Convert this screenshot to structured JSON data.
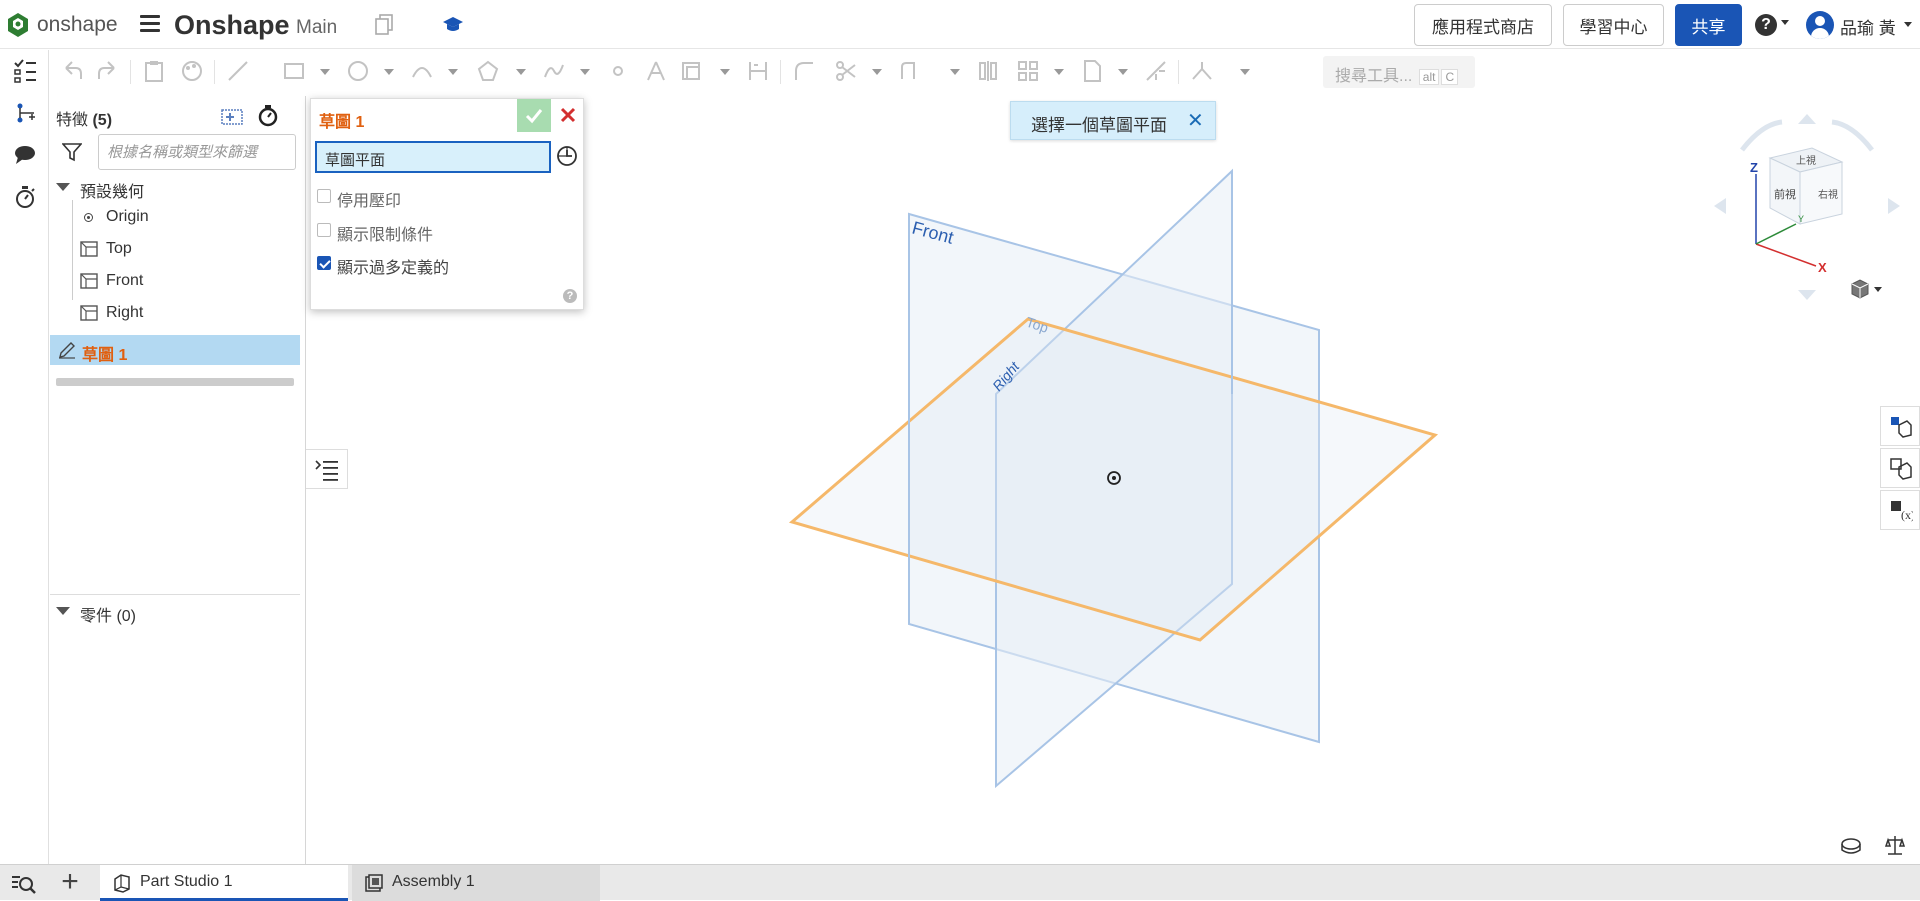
{
  "header": {
    "brand": "onshape",
    "document_title": "Onshape",
    "branch": "Main",
    "app_store": "應用程式商店",
    "learning_center": "學習中心",
    "share": "共享",
    "help": "?",
    "user_name": "品瑜 黃"
  },
  "toolbar": {
    "search_placeholder": "搜尋工具...",
    "search_shortcut_1": "alt",
    "search_shortcut_2": "C"
  },
  "feature_panel": {
    "title": "特徵",
    "count": "(5)",
    "filter_placeholder": "根據名稱或類型來篩選",
    "default_geometry": "預設幾何",
    "items": [
      "Origin",
      "Top",
      "Front",
      "Right"
    ],
    "sketch": "草圖 1",
    "parts_label": "零件 (0)"
  },
  "sketch_dialog": {
    "title": "草圖 1",
    "plane_field": "草圖平面",
    "options": [
      {
        "label": "停用壓印",
        "checked": false
      },
      {
        "label": "顯示限制條件",
        "checked": false
      },
      {
        "label": "顯示過多定義的",
        "checked": true
      }
    ],
    "help": "?"
  },
  "viewport": {
    "toast_message": "選擇一個草圖平面",
    "toast_close": "✕",
    "plane_labels": {
      "front": "Front",
      "top": "Top",
      "right": "Right"
    },
    "view_cube": {
      "top": "上視",
      "front": "前視",
      "right": "右視",
      "axis_x": "X",
      "axis_y": "Y",
      "axis_z": "Z"
    }
  },
  "tabs": [
    {
      "label": "Part Studio 1",
      "active": true
    },
    {
      "label": "Assembly 1",
      "active": false
    }
  ],
  "colors": {
    "accent": "#1a55b5",
    "sketch_orange": "#e06010",
    "plane_blue": "#a8c4e6",
    "top_plane_orange": "#f5a84a",
    "selection": "#b3d9f2"
  }
}
